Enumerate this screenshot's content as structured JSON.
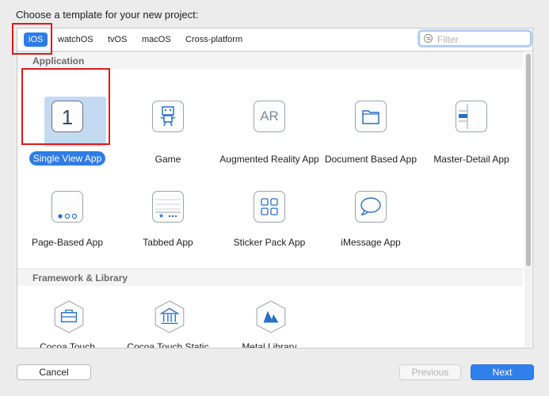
{
  "dialog": {
    "prompt": "Choose a template for your new project:"
  },
  "tabs": [
    {
      "label": "iOS",
      "selected": true
    },
    {
      "label": "watchOS",
      "selected": false
    },
    {
      "label": "tvOS",
      "selected": false
    },
    {
      "label": "macOS",
      "selected": false
    },
    {
      "label": "Cross-platform",
      "selected": false
    }
  ],
  "filter": {
    "placeholder": "Filter"
  },
  "sections": [
    {
      "title": "Application",
      "items": [
        {
          "label": "Single View App",
          "icon": "single-view-icon",
          "icon_text": "1",
          "selected": true
        },
        {
          "label": "Game",
          "icon": "game-icon"
        },
        {
          "label": "Augmented Reality App",
          "icon": "ar-icon",
          "icon_text": "AR"
        },
        {
          "label": "Document Based App",
          "icon": "folder-icon"
        },
        {
          "label": "Master-Detail App",
          "icon": "master-detail-icon"
        },
        {
          "label": "Page-Based App",
          "icon": "page-dots-icon"
        },
        {
          "label": "Tabbed App",
          "icon": "tab-bar-icon"
        },
        {
          "label": "Sticker Pack App",
          "icon": "sticker-grid-icon"
        },
        {
          "label": "iMessage App",
          "icon": "speech-bubble-icon"
        }
      ]
    },
    {
      "title": "Framework & Library",
      "items": [
        {
          "label": "Cocoa Touch Framework",
          "icon": "toolbox-icon"
        },
        {
          "label": "Cocoa Touch Static Library",
          "icon": "library-building-icon"
        },
        {
          "label": "Metal Library",
          "icon": "metal-icon"
        }
      ]
    }
  ],
  "buttons": {
    "cancel": "Cancel",
    "previous": "Previous",
    "next": "Next"
  },
  "colors": {
    "accent": "#2d7de8",
    "annotation": "#e01818"
  }
}
